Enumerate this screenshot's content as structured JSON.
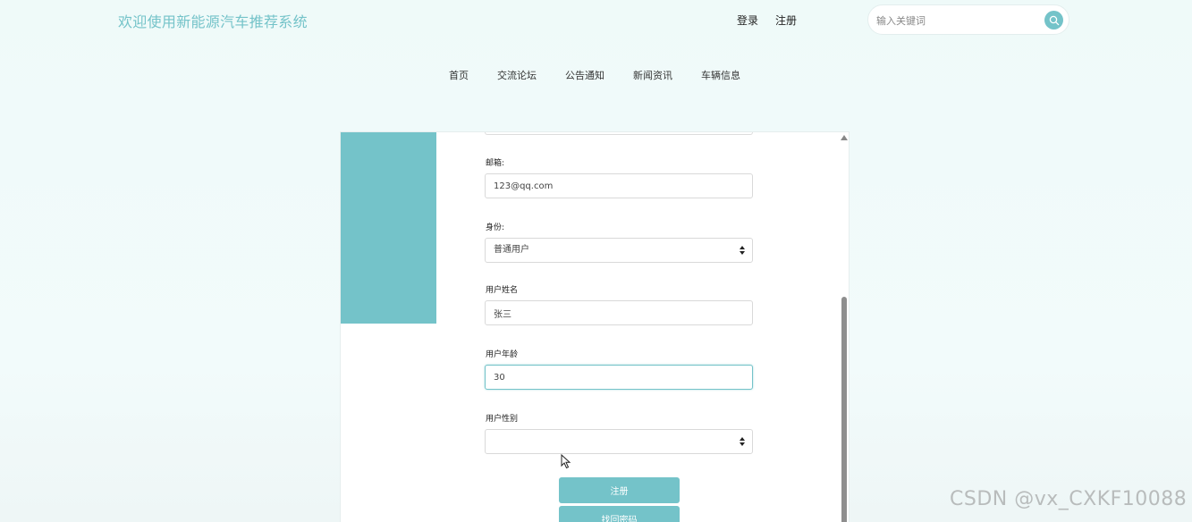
{
  "header": {
    "site_title": "欢迎使用新能源汽车推荐系统",
    "login": "登录",
    "register": "注册",
    "search_placeholder": "输入关键词",
    "search_icon": "search-icon"
  },
  "nav": {
    "items": [
      {
        "label": "首页"
      },
      {
        "label": "交流论坛"
      },
      {
        "label": "公告通知"
      },
      {
        "label": "新闻资讯"
      },
      {
        "label": "车辆信息"
      }
    ]
  },
  "form": {
    "email_label": "邮箱:",
    "email_value": "123@qq.com",
    "role_label": "身份:",
    "role_value": "普通用户",
    "name_label": "用户姓名",
    "name_value": "张三",
    "age_label": "用户年龄",
    "age_value": "30",
    "gender_label": "用户性别",
    "gender_value": "",
    "register_button": "注册",
    "recover_button": "找回密码"
  },
  "watermark": "CSDN @vx_CXKF10088",
  "colors": {
    "accent": "#74c3c9",
    "background": "#effaf9"
  }
}
